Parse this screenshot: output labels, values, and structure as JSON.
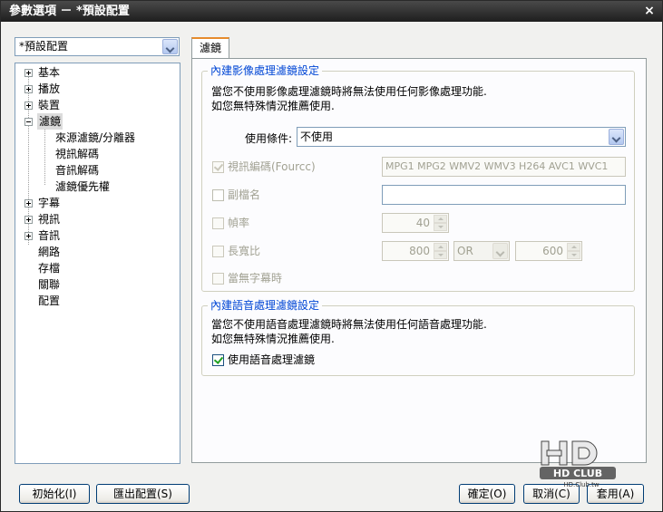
{
  "window": {
    "title": "參數選項 － *預設配置",
    "close_glyph": "×"
  },
  "preset_select": {
    "value": "*預設配置"
  },
  "tree": {
    "items": [
      {
        "label": "基本",
        "expander": "plus"
      },
      {
        "label": "播放",
        "expander": "plus"
      },
      {
        "label": "裝置",
        "expander": "plus"
      },
      {
        "label": "濾鏡",
        "expander": "minus",
        "selected": true
      },
      {
        "label": "來源濾鏡/分離器"
      },
      {
        "label": "視訊解碼"
      },
      {
        "label": "音訊解碼"
      },
      {
        "label": "濾鏡優先權"
      },
      {
        "label": "字幕",
        "expander": "plus"
      },
      {
        "label": "視訊",
        "expander": "plus"
      },
      {
        "label": "音訊",
        "expander": "plus"
      },
      {
        "label": "網路"
      },
      {
        "label": "存檔"
      },
      {
        "label": "關聯"
      },
      {
        "label": "配置"
      }
    ]
  },
  "tab": {
    "label": "濾鏡"
  },
  "video_group": {
    "title": "內建影像處理濾鏡設定",
    "desc_line1": "當您不使用影像處理濾鏡時將無法使用任何影像處理功能.",
    "desc_line2": "如您無特殊情況推薦使用.",
    "condition_label": "使用條件:",
    "condition_value": "不使用",
    "codec_label": "視訊編碼(Fourcc)",
    "codec_value": "MPG1 MPG2 WMV2 WMV3 H264 AVC1 WVC1",
    "ext_label": "副檔名",
    "ext_value": "",
    "fps_label": "幀率",
    "fps_value": "40",
    "aspect_label": "長寬比",
    "aspect_w": "800",
    "aspect_op": "OR",
    "aspect_h": "600",
    "nosub_label": "當無字幕時"
  },
  "audio_group": {
    "title": "內建語音處理濾鏡設定",
    "desc_line1": "當您不使用語音處理濾鏡時將無法使用任何語音處理功能.",
    "desc_line2": "如您無特殊情況推薦使用.",
    "use_label": "使用語音處理濾鏡"
  },
  "footer": {
    "init_label": "初始化(I)",
    "export_label": "匯出配置(S)",
    "ok_label": "確定(O)",
    "cancel_label": "取消(C)",
    "apply_label": "套用(A)"
  },
  "watermark": {
    "text": "HD CLUB",
    "url": "HD.Club.tw"
  }
}
